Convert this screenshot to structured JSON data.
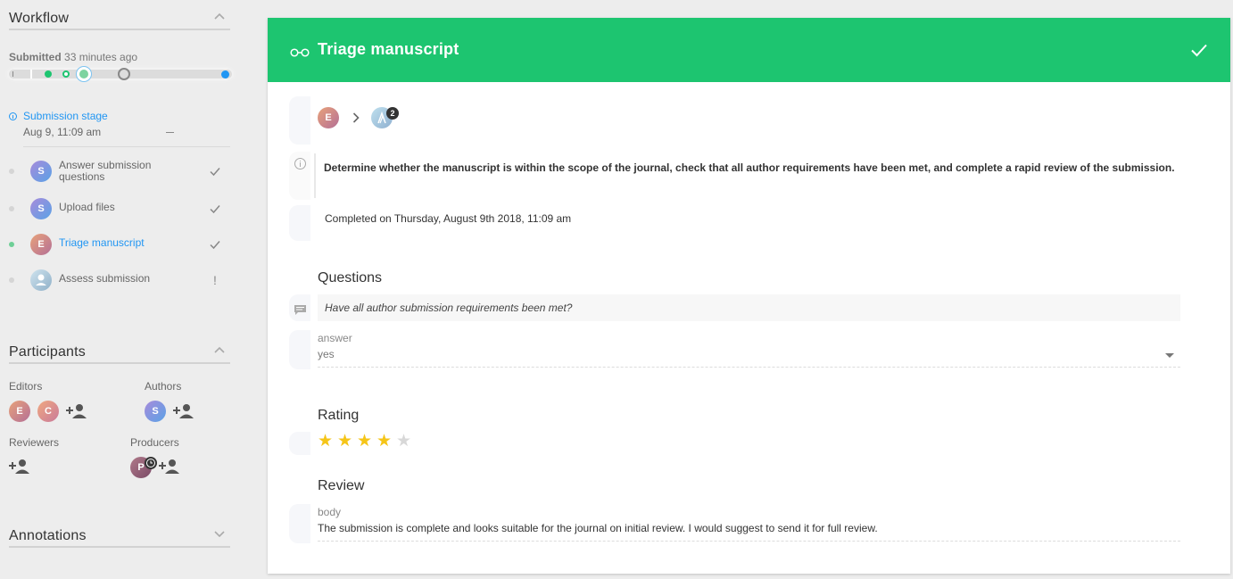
{
  "colors": {
    "accent_green": "#1dc570",
    "link_blue": "#2196f3",
    "star_gold": "#f5c518"
  },
  "sidebar": {
    "workflow": {
      "title": "Workflow",
      "submitted_label": "Submitted",
      "submitted_ago": "33 minutes ago",
      "stage_title": "Submission stage",
      "stage_date": "Aug 9, 11:09 am",
      "tasks": [
        {
          "avatar": "S",
          "label_line1": "Answer submission",
          "label_line2": "questions",
          "status": "check",
          "status_icon": "checkmark-icon"
        },
        {
          "avatar": "S",
          "label": "Upload files",
          "status": "check",
          "status_icon": "checkmark-icon"
        },
        {
          "avatar": "E",
          "label": "Triage manuscript",
          "status": "check",
          "active": true,
          "status_icon": "checkmark-icon"
        },
        {
          "avatar": "",
          "label": "Assess submission",
          "status": "!",
          "status_icon": "exclamation-icon"
        }
      ]
    },
    "participants": {
      "title": "Participants",
      "editors_label": "Editors",
      "editors": [
        "E",
        "C"
      ],
      "authors_label": "Authors",
      "authors": [
        "S"
      ],
      "reviewers_label": "Reviewers",
      "producers_label": "Producers",
      "producers": [
        "P"
      ]
    },
    "annotations": {
      "title": "Annotations"
    }
  },
  "task": {
    "title": "Triage manuscript",
    "header_icon": "glasses-icon",
    "assignee_from": "E",
    "assignee_to_count": "2",
    "description": "Determine whether the manuscript is within the scope of the journal, check that all author requirements have been met, and complete a rapid review of the submission.",
    "completed_text": "Completed on Thursday, August 9th 2018, 11:09 am",
    "questions_heading": "Questions",
    "question_text": "Have all author submission requirements been met?",
    "answer_label": "answer",
    "answer_value": "yes",
    "rating_heading": "Rating",
    "rating": 4,
    "rating_max": 5,
    "review_heading": "Review",
    "body_label": "body",
    "body_text": "The submission is complete and looks suitable for the journal on initial review. I would suggest to send it for full review."
  }
}
